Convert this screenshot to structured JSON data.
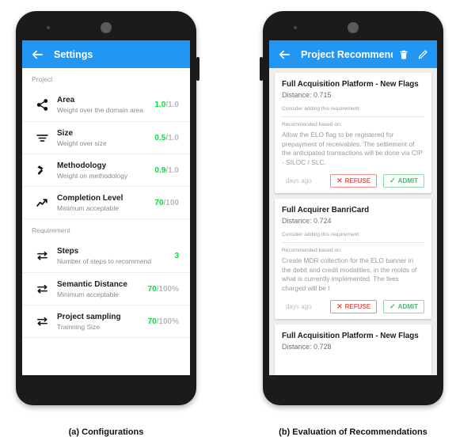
{
  "figure": {
    "caption_a": "(a) Configurations",
    "caption_b": "(b) Evaluation of Recommendations"
  },
  "colors": {
    "appbar_blue": "#2196F3",
    "value_green": "#00E03C",
    "refuse_red": "#F0544E",
    "admit_green": "#3FBF6A",
    "phone_body": "#1b1b1b",
    "list_background": "#eeeeee"
  },
  "phone_a": {
    "appbar": {
      "back_icon": "arrow-back-icon",
      "title": "Settings"
    },
    "sections": [
      {
        "label": "Project",
        "rows": [
          {
            "icon": "share-icon",
            "title": "Area",
            "subtitle": "Weight over the domain area",
            "value_num": "1.0",
            "value_max": "/1.0"
          },
          {
            "icon": "filter-icon",
            "title": "Size",
            "subtitle": "Weight over size",
            "value_num": "0.5",
            "value_max": "/1.0"
          },
          {
            "icon": "hammer-icon",
            "title": "Methodology",
            "subtitle": "Weight on methodology",
            "value_num": "0.9",
            "value_max": "/1.0"
          },
          {
            "icon": "trending-up-icon",
            "title": "Completion Level",
            "subtitle": "Minimum acceptable",
            "value_num": "70",
            "value_max": "/100"
          }
        ]
      },
      {
        "label": "Requirement",
        "rows": [
          {
            "icon": "compare-arrows-icon",
            "title": "Steps",
            "subtitle": "Number of steps to recommend",
            "value_num": "3",
            "value_max": ""
          },
          {
            "icon": "compare-arrows-icon",
            "title": "Semantic Distance",
            "subtitle": "Minimum acceptable",
            "value_num": "70",
            "value_max": "/100%"
          },
          {
            "icon": "compare-arrows-icon",
            "title": "Project sampling",
            "subtitle": "Trainning Size",
            "value_num": "70",
            "value_max": "/100%"
          }
        ]
      }
    ]
  },
  "phone_b": {
    "appbar": {
      "back_icon": "arrow-back-icon",
      "title": "Project Recommend...",
      "delete_icon": "trash-icon",
      "edit_icon": "pencil-icon"
    },
    "cards": [
      {
        "title": "Full Acquisition Platform - New Flags",
        "distance": "Distance: 0.715",
        "hint": "Consider adding this requirement:",
        "based_on_label": "Recommended based on:",
        "body": "Allow the ELO flag to be registered for prepayment of receivables. The settlement of the anticipated transactions will be done via CIP - SILOC / SLC.",
        "days_ago": "days ago",
        "refuse_label": "REFUSE",
        "admit_label": "ADMIT",
        "refuse_glyph": "✕",
        "admit_glyph": "✓"
      },
      {
        "title": "Full Acquirer BanriCard",
        "distance": "Distance: 0.724",
        "hint": "Consider adding this requirement:",
        "based_on_label": "Recommended based on:",
        "body": "Create MDR collection for the ELO banner in the debit and credit modalities, in the molds of what is currently implemented. The fees charged will be t",
        "days_ago": "days ago",
        "refuse_label": "REFUSE",
        "admit_label": "ADMIT",
        "refuse_glyph": "✕",
        "admit_glyph": "✓"
      },
      {
        "title": "Full Acquisition Platform - New Flags",
        "distance": "Distance: 0.728"
      }
    ]
  }
}
